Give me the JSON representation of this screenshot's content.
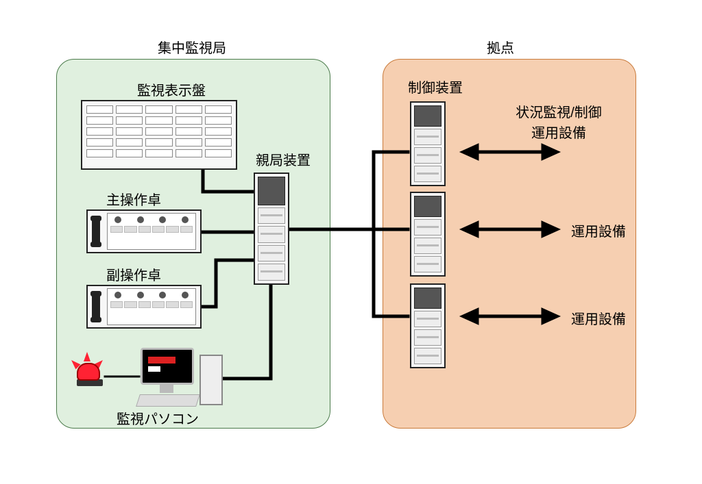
{
  "headers": {
    "central_station": "集中監視局",
    "site": "拠点"
  },
  "central": {
    "display_board_label": "監視表示盤",
    "master_unit_label": "親局装置",
    "main_console_label": "主操作卓",
    "sub_console_label": "副操作卓",
    "monitor_pc_label": "監視パソコン"
  },
  "site": {
    "controller_label": "制御装置",
    "rack1_text": "状況監視/制御\n運用設備",
    "rack2_text": "運用設備",
    "rack3_text": "運用設備"
  },
  "icons": {
    "display_board": "display-board",
    "main_console": "operator-console",
    "sub_console": "operator-console",
    "master_rack": "server-rack",
    "site_rack": "server-rack",
    "beacon": "warning-light",
    "pc": "desktop-pc"
  }
}
